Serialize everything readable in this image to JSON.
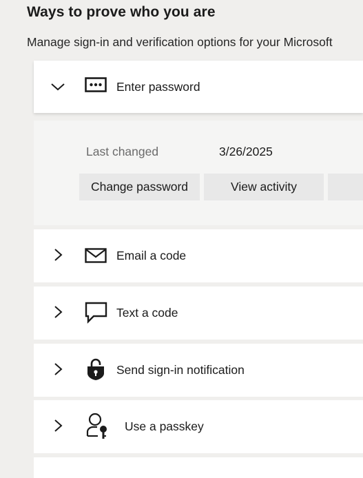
{
  "page": {
    "title": "Ways to prove who you are",
    "subtitle": "Manage sign-in and verification options for your Microsoft"
  },
  "methods": [
    {
      "label": "Enter password",
      "icon": "password-icon",
      "expanded": true
    },
    {
      "label": "Email a code",
      "icon": "mail-icon",
      "expanded": false
    },
    {
      "label": "Text a code",
      "icon": "chat-bubble-icon",
      "expanded": false
    },
    {
      "label": "Send sign-in notification",
      "icon": "lock-shield-icon",
      "expanded": false
    },
    {
      "label": "Use a passkey",
      "icon": "person-key-icon",
      "expanded": false
    }
  ],
  "password_details": {
    "last_changed_label": "Last changed",
    "last_changed_value": "3/26/2025",
    "change_password_label": "Change password",
    "view_activity_label": "View activity"
  }
}
